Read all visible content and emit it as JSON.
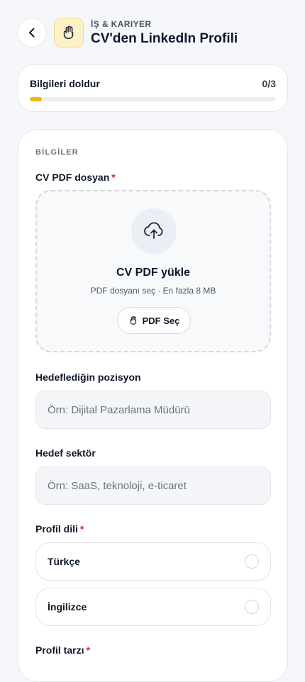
{
  "header": {
    "category": "İŞ & KARIYER",
    "title": "CV'den LinkedIn Profili"
  },
  "progress": {
    "label": "Bilgileri doldur",
    "count": "0/3",
    "fraction": 0.05,
    "fill_color": "#f0b90b"
  },
  "form": {
    "section_title": "BİLGİLER",
    "cv_pdf": {
      "label": "CV PDF dosyan",
      "required": "*",
      "upload_title": "CV PDF yükle",
      "upload_hint": "PDF dosyanı seç · En fazla 8 MB",
      "button_label": "PDF Seç"
    },
    "position": {
      "label": "Hedeflediğin pozisyon",
      "placeholder": "Örn: Dijital Pazarlama Müdürü",
      "value": ""
    },
    "sector": {
      "label": "Hedef sektör",
      "placeholder": "Örn: SaaS, teknoloji, e-ticaret",
      "value": ""
    },
    "language": {
      "label": "Profil dili",
      "required": "*",
      "options": [
        {
          "label": "Türkçe",
          "selected": false
        },
        {
          "label": "İngilizce",
          "selected": false
        }
      ]
    },
    "style": {
      "label": "Profil tarzı",
      "required": "*"
    }
  },
  "icons": {
    "back": "chevron-left-icon",
    "app": "hand-icon",
    "upload": "cloud-upload-icon",
    "button": "hand-pointer-icon"
  },
  "colors": {
    "accent": "#f0b90b",
    "required": "#dc2626"
  }
}
